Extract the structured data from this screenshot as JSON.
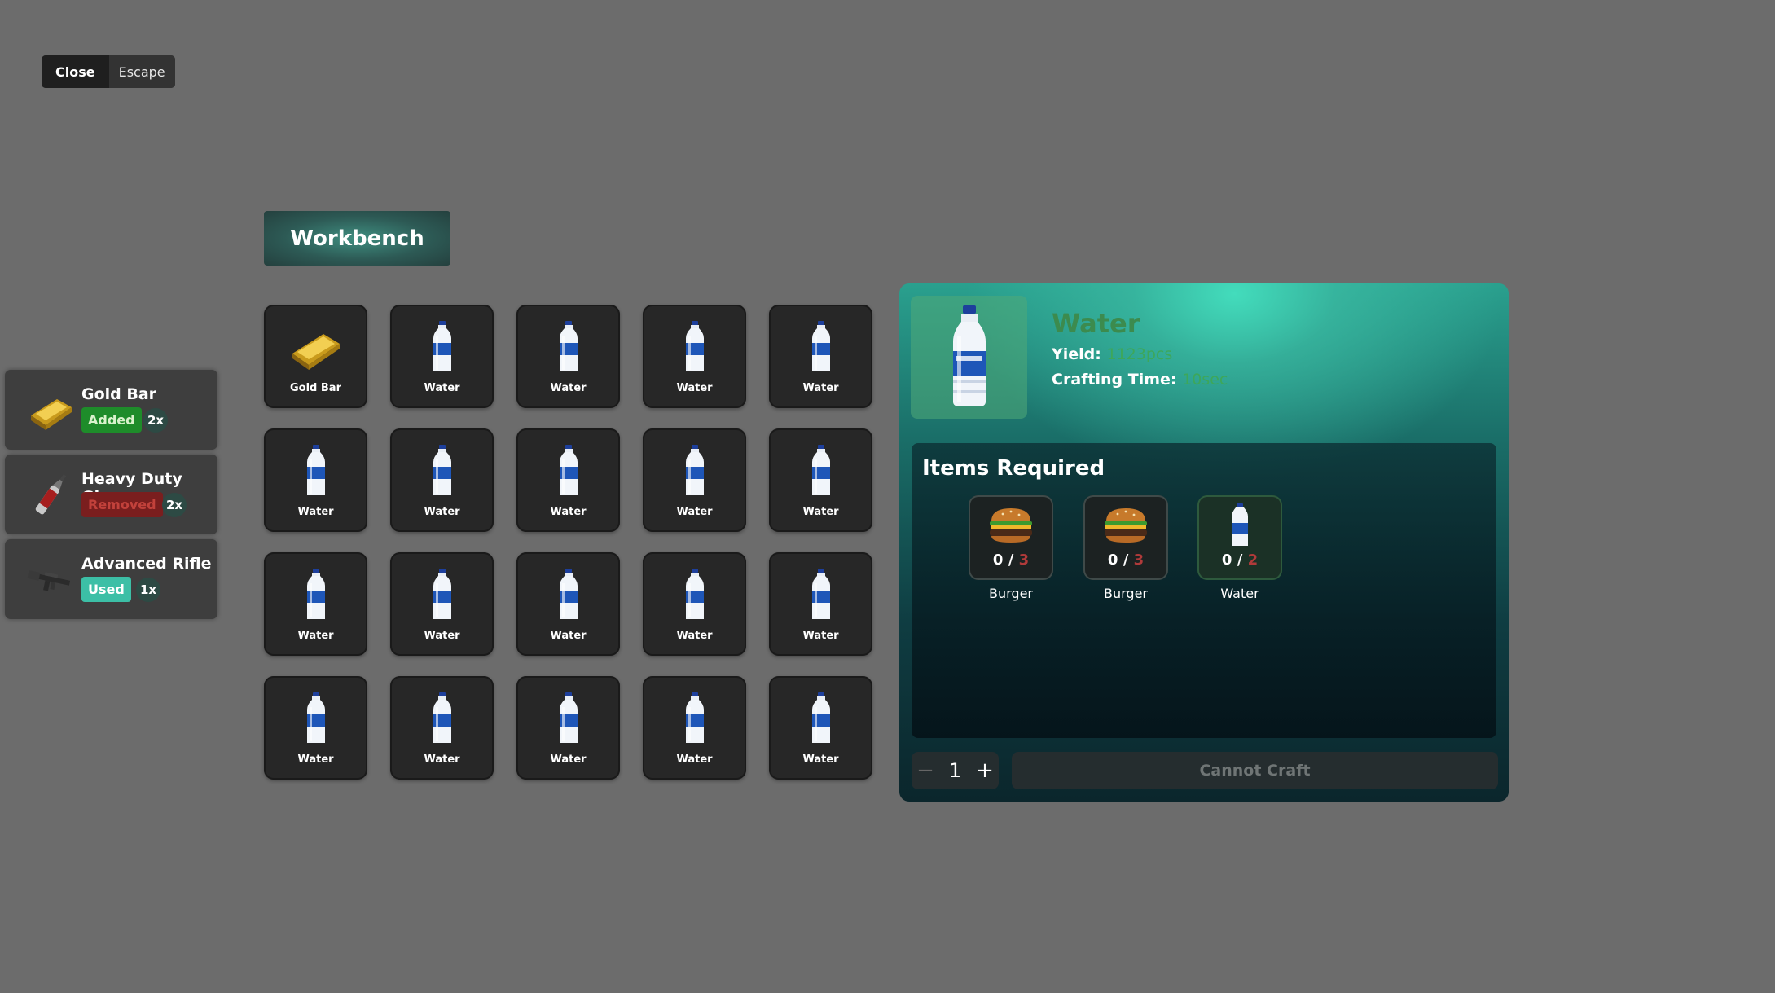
{
  "close_hint": {
    "key": "Close",
    "label": "Escape"
  },
  "notifications": [
    {
      "title": "Gold Bar",
      "status": "Added",
      "count": "2x",
      "icon": "gold-bar-icon",
      "status_color": "#1e8c2a"
    },
    {
      "title": "Heavy Duty Glue",
      "status": "Removed",
      "count": "2x",
      "icon": "glue-tube-icon",
      "status_color": "#7a1e1e"
    },
    {
      "title": "Advanced Rifle",
      "status": "Used",
      "count": "1x",
      "icon": "rifle-icon",
      "status_color": "#3cbfa6"
    }
  ],
  "workbench": {
    "title": "Workbench"
  },
  "grid_items": [
    "Gold Bar",
    "Water",
    "Water",
    "Water",
    "Water",
    "Water",
    "Water",
    "Water",
    "Water",
    "Water",
    "Water",
    "Water",
    "Water",
    "Water",
    "Water",
    "Water",
    "Water",
    "Water",
    "Water",
    "Water"
  ],
  "detail": {
    "name": "Water",
    "yield_label": "Yield:",
    "yield_value": "1123pcs",
    "time_label": "Crafting Time:",
    "time_value": "10sec",
    "required_title": "Items Required",
    "required": [
      {
        "name": "Burger",
        "have": "0 /",
        "need": "3",
        "icon": "burger-icon"
      },
      {
        "name": "Burger",
        "have": "0 /",
        "need": "3",
        "icon": "burger-icon"
      },
      {
        "name": "Water",
        "have": "0 /",
        "need": "2",
        "icon": "water-bottle-icon"
      }
    ],
    "quantity": "1",
    "minus": "−",
    "plus": "+",
    "craft_label": "Cannot Craft"
  },
  "colors": {
    "accent": "#3fd7b8",
    "background": "#6c6c6c",
    "added": "#1e8c2a",
    "removed": "#7a1e1e",
    "used": "#3cbfa6"
  }
}
